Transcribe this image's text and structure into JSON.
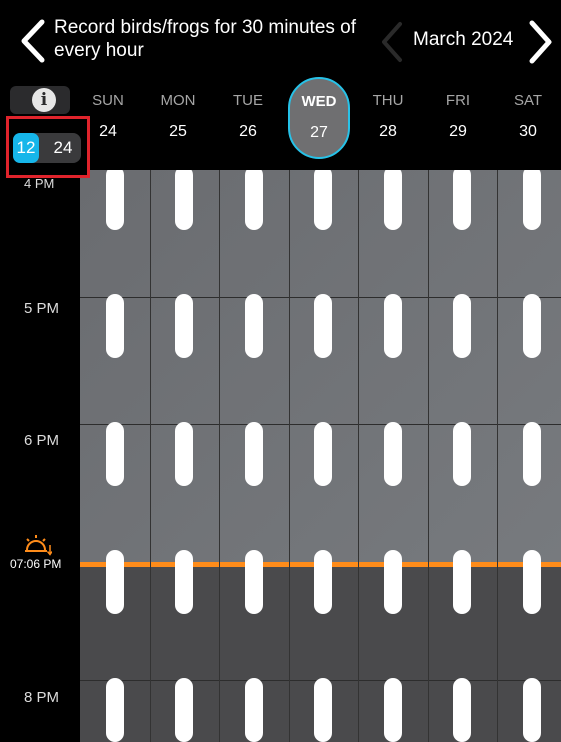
{
  "header": {
    "title": "Record birds/frogs for 30 minutes of every hour",
    "month": "March 2024"
  },
  "time_format": {
    "option_12": "12",
    "option_24": "24",
    "selected": "12"
  },
  "days": [
    {
      "name": "SUN",
      "date": "24"
    },
    {
      "name": "MON",
      "date": "25"
    },
    {
      "name": "TUE",
      "date": "26"
    },
    {
      "name": "WED",
      "date": "27",
      "selected": true
    },
    {
      "name": "THU",
      "date": "28"
    },
    {
      "name": "FRI",
      "date": "29"
    },
    {
      "name": "SAT",
      "date": "30"
    }
  ],
  "times": {
    "t4": "4 PM",
    "t5": "5 PM",
    "t6": "6 PM",
    "sunset": "07:06 PM",
    "t8": "8 PM"
  },
  "colors": {
    "accent": "#16b6ea",
    "sunset": "#ff8c1a",
    "highlight_box": "#e0242c"
  },
  "icons": {
    "back": "chevron-left-icon",
    "prev": "chevron-left-icon",
    "next": "chevron-right-icon",
    "info": "info-icon",
    "sunset": "sunset-icon"
  }
}
